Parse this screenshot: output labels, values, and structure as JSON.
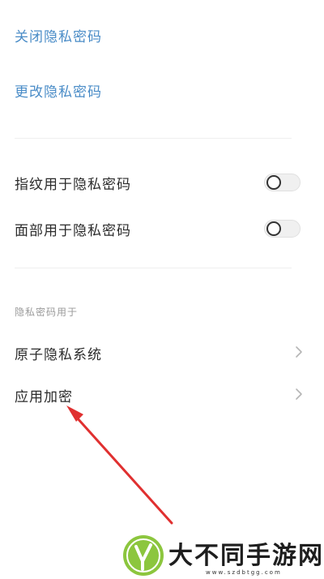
{
  "links": [
    {
      "label": "关闭隐私密码"
    },
    {
      "label": "更改隐私密码"
    }
  ],
  "toggles": [
    {
      "label": "指纹用于隐私密码",
      "on": false
    },
    {
      "label": "面部用于隐私密码",
      "on": false
    }
  ],
  "section": {
    "header": "隐私密码用于",
    "items": [
      {
        "label": "原子隐私系统"
      },
      {
        "label": "应用加密"
      }
    ]
  },
  "annotation": {
    "arrow_color": "#e03030"
  },
  "watermark": {
    "text": "大不同手游网",
    "url": "www.szdbtgg.com",
    "logo_color": "#8cc63e"
  },
  "colors": {
    "link": "#4a8cc7",
    "text": "#2b2b2b",
    "muted": "#9a9a9a"
  }
}
